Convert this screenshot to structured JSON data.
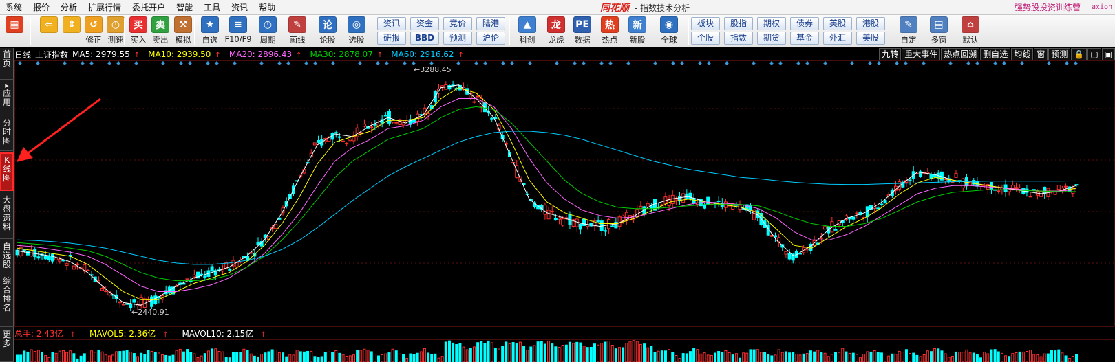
{
  "menubar": {
    "items": [
      "系统",
      "报价",
      "分析",
      "扩展行情",
      "委托开户",
      "智能",
      "工具",
      "资讯",
      "帮助"
    ],
    "app_logo": "同花顺",
    "app_subtitle": "- 指数技术分析",
    "promo": "强势股投资训练营",
    "promo_user": "axion"
  },
  "toolbar": {
    "left_buttons": [
      {
        "id": "color-block",
        "label": "",
        "icon": "grid-icon",
        "color": "#e04020"
      },
      {
        "id": "back",
        "label": "",
        "icon": "arrow-left-icon",
        "color": "#f0b020"
      },
      {
        "id": "updown",
        "label": "",
        "icon": "arrow-updown-icon",
        "color": "#f0b020"
      },
      {
        "id": "revise",
        "label": "修正",
        "icon": "revise-icon",
        "color": "#f0a020"
      },
      {
        "id": "test",
        "label": "测速",
        "icon": "clock-icon",
        "color": "#e0a030"
      },
      {
        "id": "buy",
        "label": "买入",
        "icon": "buy-icon",
        "color": "#e83030"
      },
      {
        "id": "sell",
        "label": "卖出",
        "icon": "sell-icon",
        "color": "#30a040"
      },
      {
        "id": "simulate",
        "label": "模拟",
        "icon": "hammer-icon",
        "color": "#c07030"
      },
      {
        "id": "watchlist",
        "label": "自选",
        "icon": "star-icon",
        "color": "#3070c0"
      },
      {
        "id": "f10",
        "label": "F10/F9",
        "icon": "f10-icon",
        "color": "#3070c0"
      },
      {
        "id": "period",
        "label": "周期",
        "icon": "period-icon",
        "color": "#3070c0"
      },
      {
        "id": "draw",
        "label": "画线",
        "icon": "pencil-icon",
        "color": "#c04040"
      },
      {
        "id": "forum",
        "label": "论股",
        "icon": "forum-icon",
        "color": "#3070c0"
      },
      {
        "id": "pick",
        "label": "选股",
        "icon": "pick-icon",
        "color": "#3070c0"
      }
    ],
    "grid_buttons": [
      [
        "资讯",
        "研报"
      ],
      [
        "资金",
        "BBD"
      ],
      [
        "竞价",
        "预测"
      ],
      [
        "陆港",
        "沪伦"
      ]
    ],
    "middle_buttons": [
      {
        "id": "kechuang",
        "label": "科创",
        "icon": "kechuang-icon",
        "color": "#4080d0"
      },
      {
        "id": "longhu",
        "label": "龙虎",
        "icon": "dragon-icon",
        "color": "#d03030"
      },
      {
        "id": "data",
        "label": "数据",
        "icon": "pe-icon",
        "color": "#3060b0"
      },
      {
        "id": "hot",
        "label": "热点",
        "icon": "hot-icon",
        "color": "#e04020"
      },
      {
        "id": "newstock",
        "label": "新股",
        "icon": "newstock-icon",
        "color": "#4080d0"
      },
      {
        "id": "global",
        "label": "全球",
        "icon": "globe-icon",
        "color": "#3070c0"
      }
    ],
    "grid_buttons_2": [
      [
        "板块",
        "个股"
      ],
      [
        "股指",
        "指数"
      ],
      [
        "期权",
        "期货"
      ],
      [
        "债券",
        "基金"
      ],
      [
        "英股",
        "外汇"
      ],
      [
        "港股",
        "美股"
      ]
    ],
    "right_buttons": [
      {
        "id": "custom",
        "label": "自定",
        "icon": "custom-icon",
        "color": "#5080c0"
      },
      {
        "id": "multiwin",
        "label": "多窗",
        "icon": "multiwin-icon",
        "color": "#5080c0"
      },
      {
        "id": "default",
        "label": "默认",
        "icon": "home-icon",
        "color": "#c04040"
      }
    ]
  },
  "left_nav": [
    {
      "label": "首页",
      "active": false
    },
    {
      "label": "应用",
      "active": false
    },
    {
      "label": "分时图",
      "active": false
    },
    {
      "label": "K线图",
      "active": true
    },
    {
      "label": "大盘资料",
      "active": false
    },
    {
      "label": "自选股",
      "active": false
    },
    {
      "label": "综合排名",
      "active": false
    },
    {
      "label": "更多",
      "active": false
    }
  ],
  "chart_header": {
    "period": "日线",
    "name": "上证指数",
    "ma5": "MA5: 2979.55",
    "ma10": "MA10: 2939.50",
    "ma20": "MA20: 2896.43",
    "ma30": "MA30: 2878.07",
    "ma60": "MA60: 2916.62",
    "arrow": "↑",
    "colors": {
      "ma5": "#ffffff",
      "ma10": "#ffff00",
      "ma20": "#ff66ff",
      "ma30": "#00cc00",
      "ma60": "#00ccff"
    }
  },
  "right_tabs": [
    "九转",
    "重大事件",
    "热点回溯",
    "删自选",
    "均线",
    "窗",
    "预测",
    "🔒",
    "▢",
    "▣"
  ],
  "volume_header": {
    "total": "总手: 2.43亿",
    "mavol5": "MAVOL5: 2.36亿",
    "mavol10": "MAVOL10: 2.15亿",
    "arrow": "↑"
  },
  "chart_data": {
    "type": "line",
    "title": "",
    "high_label": "3288.45",
    "low_label": "2440.91",
    "ylim": [
      2400,
      3330
    ],
    "x": [
      0,
      5,
      10,
      15,
      20,
      25,
      30,
      35,
      40,
      45,
      50,
      55,
      60,
      65,
      70,
      75,
      80,
      85,
      90,
      95,
      100,
      105,
      110,
      115,
      120,
      125,
      130,
      135,
      140,
      145,
      150,
      155,
      160,
      165,
      170,
      175,
      180,
      185,
      190,
      195,
      200,
      205,
      210,
      215,
      220,
      225,
      230,
      235,
      240,
      245,
      250,
      255,
      260,
      265,
      270,
      275,
      280,
      285,
      290,
      295,
      300
    ],
    "series": [
      {
        "name": "MA5",
        "color": "#ffffff",
        "values": [
          2660,
          2650,
          2640,
          2620,
          2580,
          2520,
          2470,
          2460,
          2490,
          2530,
          2560,
          2580,
          2600,
          2640,
          2700,
          2800,
          2930,
          3050,
          3090,
          3080,
          3120,
          3150,
          3130,
          3160,
          3260,
          3270,
          3220,
          3150,
          3000,
          2850,
          2800,
          2780,
          2760,
          2750,
          2760,
          2790,
          2830,
          2850,
          2860,
          2840,
          2830,
          2820,
          2790,
          2700,
          2640,
          2680,
          2740,
          2780,
          2800,
          2840,
          2900,
          2950,
          2940,
          2920,
          2910,
          2900,
          2890,
          2880,
          2870,
          2880,
          2900
        ]
      },
      {
        "name": "MA10",
        "color": "#ffff00",
        "values": [
          2670,
          2660,
          2650,
          2640,
          2610,
          2560,
          2510,
          2480,
          2480,
          2510,
          2540,
          2560,
          2580,
          2620,
          2680,
          2760,
          2860,
          2980,
          3060,
          3080,
          3100,
          3140,
          3140,
          3150,
          3220,
          3260,
          3240,
          3180,
          3060,
          2920,
          2840,
          2800,
          2780,
          2760,
          2760,
          2780,
          2810,
          2840,
          2850,
          2840,
          2830,
          2820,
          2800,
          2740,
          2680,
          2670,
          2710,
          2750,
          2780,
          2820,
          2870,
          2910,
          2930,
          2920,
          2910,
          2900,
          2890,
          2885,
          2880,
          2880,
          2890
        ]
      },
      {
        "name": "MA20",
        "color": "#ff66ff",
        "values": [
          2680,
          2675,
          2665,
          2655,
          2640,
          2610,
          2570,
          2530,
          2510,
          2510,
          2520,
          2535,
          2560,
          2600,
          2650,
          2720,
          2800,
          2900,
          2990,
          3040,
          3070,
          3110,
          3120,
          3140,
          3190,
          3220,
          3220,
          3190,
          3110,
          3000,
          2910,
          2850,
          2810,
          2790,
          2780,
          2785,
          2800,
          2815,
          2830,
          2840,
          2835,
          2830,
          2815,
          2780,
          2730,
          2700,
          2700,
          2720,
          2750,
          2790,
          2830,
          2870,
          2890,
          2900,
          2900,
          2895,
          2890,
          2885,
          2880,
          2880,
          2885
        ]
      },
      {
        "name": "MA30",
        "color": "#00cc00",
        "values": [
          2690,
          2685,
          2680,
          2670,
          2660,
          2640,
          2610,
          2580,
          2560,
          2550,
          2550,
          2555,
          2570,
          2600,
          2640,
          2700,
          2770,
          2850,
          2930,
          2990,
          3030,
          3070,
          3090,
          3110,
          3150,
          3180,
          3190,
          3180,
          3130,
          3060,
          2990,
          2920,
          2870,
          2840,
          2820,
          2815,
          2815,
          2820,
          2825,
          2830,
          2830,
          2830,
          2825,
          2805,
          2780,
          2760,
          2750,
          2750,
          2760,
          2780,
          2810,
          2840,
          2860,
          2875,
          2880,
          2885,
          2885,
          2882,
          2880,
          2878,
          2878
        ]
      },
      {
        "name": "MA60",
        "color": "#00ccff",
        "values": [
          2700,
          2698,
          2694,
          2688,
          2680,
          2670,
          2655,
          2640,
          2625,
          2615,
          2610,
          2610,
          2615,
          2625,
          2640,
          2665,
          2700,
          2745,
          2795,
          2845,
          2890,
          2935,
          2970,
          3000,
          3030,
          3060,
          3080,
          3095,
          3100,
          3100,
          3095,
          3085,
          3070,
          3050,
          3030,
          3010,
          2990,
          2975,
          2960,
          2950,
          2940,
          2930,
          2925,
          2918,
          2912,
          2908,
          2905,
          2904,
          2904,
          2906,
          2908,
          2910,
          2912,
          2914,
          2915,
          2916,
          2916,
          2916,
          2916,
          2916,
          2917
        ]
      }
    ]
  }
}
